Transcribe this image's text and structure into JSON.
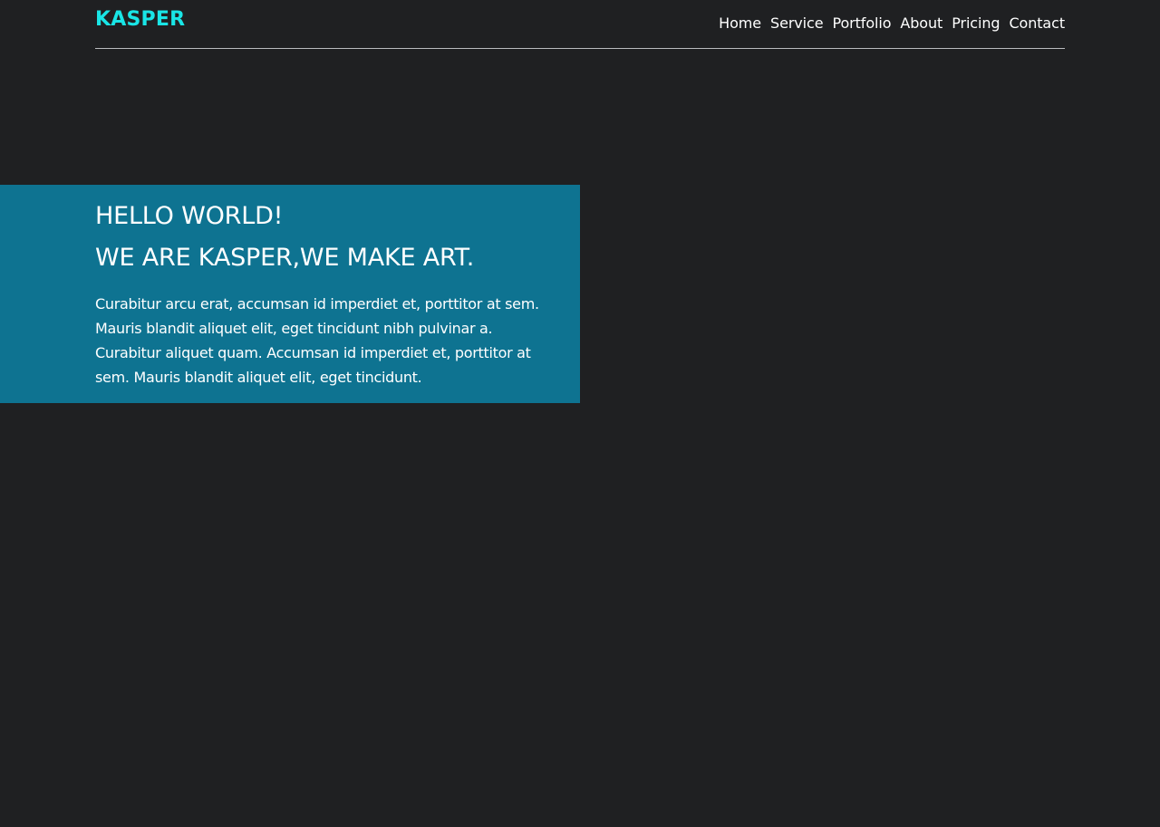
{
  "colors": {
    "background": "#1f2022",
    "accent": "#19e5e6",
    "hero_background": "#0e7391",
    "text": "#ffffff",
    "divider": "#b9bcbf"
  },
  "header": {
    "logo": "KASPER",
    "nav": [
      {
        "label": "Home"
      },
      {
        "label": "Service"
      },
      {
        "label": "Portfolio"
      },
      {
        "label": "About"
      },
      {
        "label": "Pricing"
      },
      {
        "label": "Contact"
      }
    ]
  },
  "hero": {
    "title": "HELLO WORLD!",
    "subtitle": "WE ARE KASPER,WE MAKE ART.",
    "text": "Curabitur arcu erat, accumsan id imperdiet et, porttitor at sem. Mauris blandit aliquet elit, eget tincidunt nibh pulvinar a. Curabitur aliquet quam. Accumsan id imperdiet et, porttitor at sem. Mauris blandit aliquet elit, eget tincidunt."
  }
}
